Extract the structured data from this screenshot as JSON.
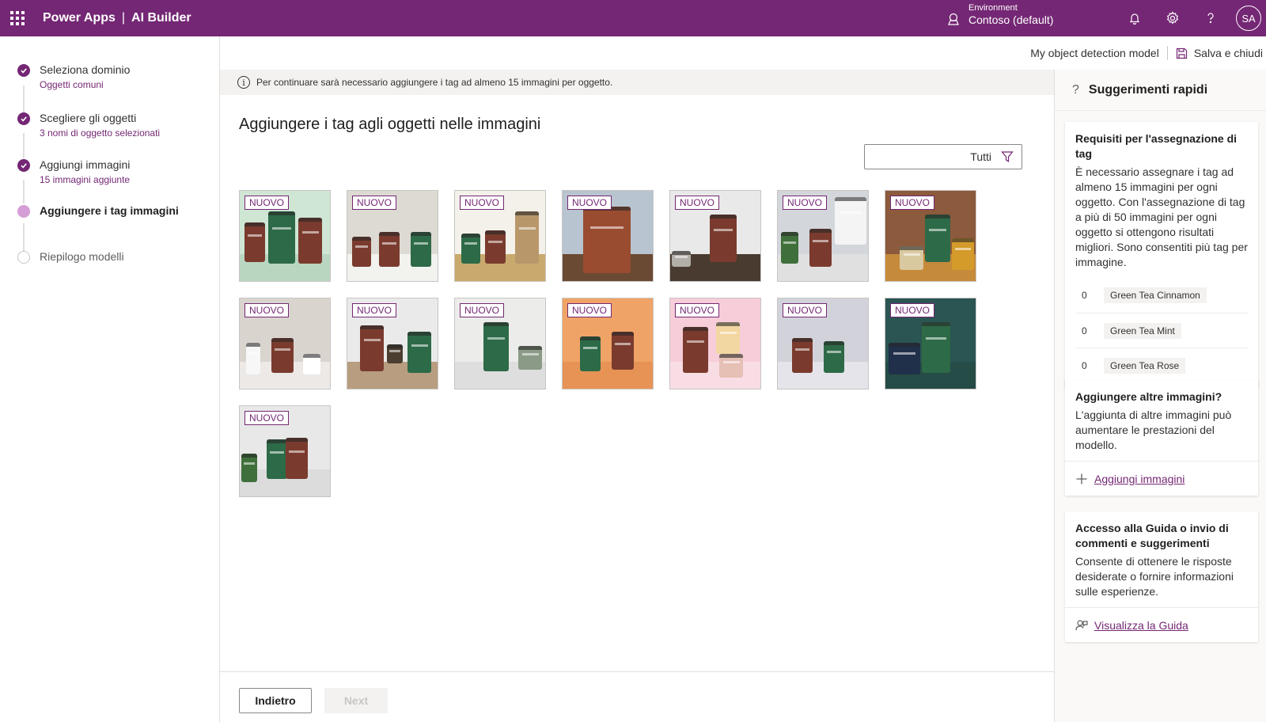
{
  "topbar": {
    "app_name": "Power Apps",
    "separator": "|",
    "product": "AI Builder",
    "env_label": "Environment",
    "env_value": "Contoso (default)",
    "avatar_initials": "SA"
  },
  "steps": [
    {
      "title": "Seleziona dominio",
      "sub": "Oggetti comuni",
      "status": "done"
    },
    {
      "title": "Scegliere gli oggetti",
      "sub": "3 nomi di oggetto selezionati",
      "status": "done"
    },
    {
      "title": "Aggiungi immagini",
      "sub": "15  immagini aggiunte",
      "status": "done"
    },
    {
      "title": "Aggiungere i tag immagini",
      "sub": "",
      "status": "current"
    },
    {
      "title": "Riepilogo modelli",
      "sub": "",
      "status": "pending"
    }
  ],
  "header": {
    "model_name": "My object detection model",
    "save_label": "Salva e chiudi"
  },
  "info": {
    "message": "Per continuare sarà necessario aggiungere i tag ad almeno 15 immagini per oggetto."
  },
  "main": {
    "title": "Aggiungere i tag agli oggetti nelle immagini",
    "filter_value": "Tutti",
    "badge_label": "NUOVO",
    "tile_count": 15
  },
  "footer": {
    "back_label": "Indietro",
    "next_label": "Next"
  },
  "tips": {
    "title": "Suggerimenti rapidi",
    "card1": {
      "title": "Requisiti per l'assegnazione di tag",
      "text": "È necessario assegnare i tag ad almeno 15 immagini per ogni oggetto. Con l'assegnazione di tag a più di 50 immagini per ogni oggetto si ottengono risultati migliori. Sono consentiti più tag per immagine.",
      "tags": [
        {
          "count": "0",
          "name": "Green Tea Cinnamon"
        },
        {
          "count": "0",
          "name": "Green Tea Mint"
        },
        {
          "count": "0",
          "name": "Green Tea Rose"
        }
      ]
    },
    "card2": {
      "title": "Aggiungere altre immagini?",
      "text": "L'aggiunta di altre immagini può aumentare le prestazioni del modello.",
      "link": "Aggiungi immagini"
    },
    "card3": {
      "title": "Accesso alla Guida o invio di commenti e suggerimenti",
      "text": "Consente di ottenere le risposte desiderate o fornire informazioni sulle esperienze.",
      "link": "Visualizza la Guida"
    }
  },
  "colors": {
    "brand": "#742774",
    "current_step": "#d59ed7",
    "can_green": "#2d6a47",
    "can_brown": "#7a3b2e"
  }
}
